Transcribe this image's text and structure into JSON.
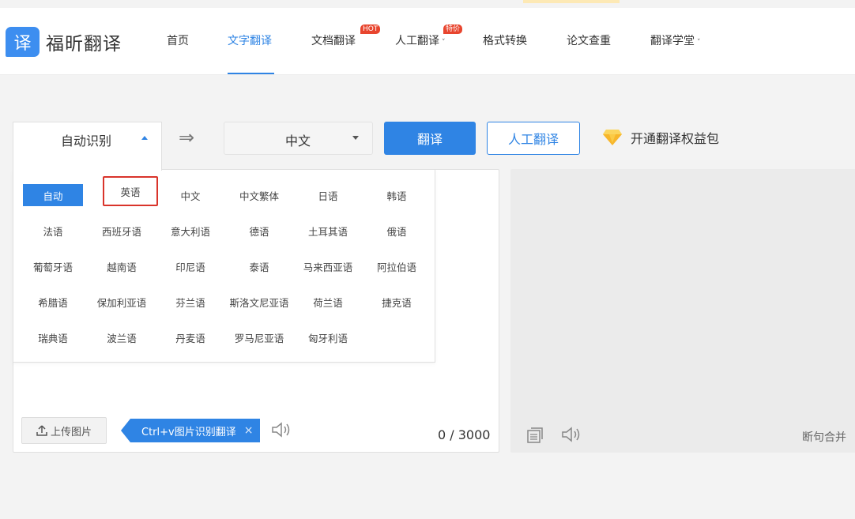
{
  "header": {
    "logo_badge": "译",
    "logo_text": "福昕翻译",
    "nav": [
      {
        "label": "首页"
      },
      {
        "label": "文字翻译",
        "active": true
      },
      {
        "label": "文档翻译",
        "tag": "HOT"
      },
      {
        "label": "人工翻译",
        "tag": "特价",
        "caret": "˅"
      },
      {
        "label": "格式转换"
      },
      {
        "label": "论文查重"
      },
      {
        "label": "翻译学堂",
        "caret": "˅"
      }
    ]
  },
  "toolbar": {
    "source_lang": "自动识别",
    "swap_icon": "⇒",
    "target_lang": "中文",
    "translate_label": "翻译",
    "human_label": "人工翻译",
    "vip_label": "开通翻译权益包"
  },
  "languages": [
    "自动",
    "英语",
    "中文",
    "中文繁体",
    "日语",
    "韩语",
    "法语",
    "西班牙语",
    "意大利语",
    "德语",
    "土耳其语",
    "俄语",
    "葡萄牙语",
    "越南语",
    "印尼语",
    "泰语",
    "马来西亚语",
    "阿拉伯语",
    "希腊语",
    "保加利亚语",
    "芬兰语",
    "斯洛文尼亚语",
    "荷兰语",
    "捷克语",
    "瑞典语",
    "波兰语",
    "丹麦语",
    "罗马尼亚语",
    "匈牙利语"
  ],
  "source_panel": {
    "upload_label": "上传图片",
    "ctrlv_label": "Ctrl+v图片识别翻译",
    "close_x": "×",
    "count": "0 / 3000"
  },
  "target_panel": {
    "merge_label": "断句合并"
  },
  "colors": {
    "accent": "#2f84e4",
    "highlight_border": "#d9342b",
    "hot_tag": "#e8452e"
  }
}
